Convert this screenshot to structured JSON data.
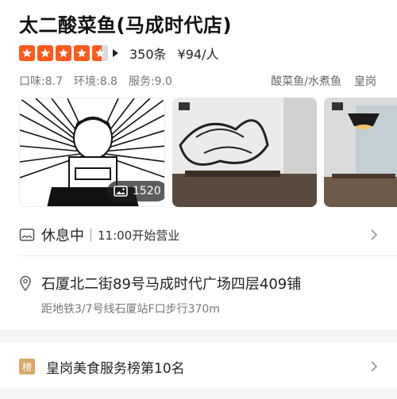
{
  "shop": {
    "name": "太二酸菜鱼(马成时代店)",
    "rating_stars": 4.5,
    "reviews": "350条",
    "price": "¥94/人"
  },
  "scores": [
    {
      "label": "口味:8.7"
    },
    {
      "label": "环境:8.8"
    },
    {
      "label": "服务:9.0"
    }
  ],
  "tags": [
    "酸菜鱼/水煮鱼",
    "皇岗"
  ],
  "gallery": {
    "photo_count": "1520"
  },
  "status": {
    "main": "休息中",
    "sub": "11:00开始营业"
  },
  "address": {
    "text": "石厦北二街89号马成时代广场四层409铺",
    "metro": "距地铁3/7号线石厦站F口步行370m"
  },
  "ranking": {
    "badge": "榜",
    "text": "皇岗美食服务榜第10名"
  },
  "colors": {
    "star": "#ff5a1e",
    "rank_badge": "#d9a86a"
  }
}
